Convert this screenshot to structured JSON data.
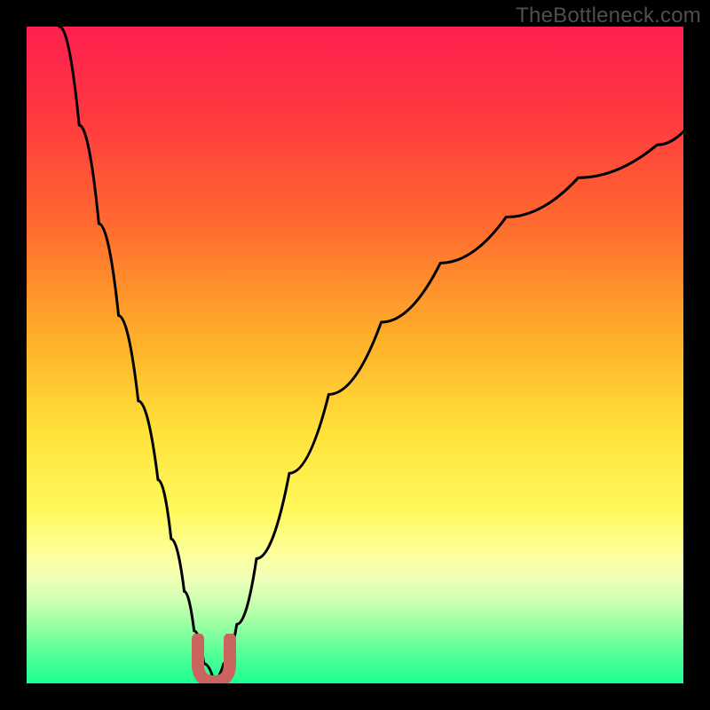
{
  "watermark": "TheBottleneck.com",
  "colors": {
    "black": "#000000",
    "marker": "#c9645f",
    "curve": "#000000",
    "gradient_stops": [
      {
        "pct": 0,
        "color": "#ff1f4f"
      },
      {
        "pct": 14,
        "color": "#ff3a3f"
      },
      {
        "pct": 30,
        "color": "#ff6a2f"
      },
      {
        "pct": 48,
        "color": "#ffb12a"
      },
      {
        "pct": 62,
        "color": "#ffe33a"
      },
      {
        "pct": 74,
        "color": "#fff95e"
      },
      {
        "pct": 80,
        "color": "#fdff9a"
      },
      {
        "pct": 84,
        "color": "#f0ffb8"
      },
      {
        "pct": 88,
        "color": "#c7ffb0"
      },
      {
        "pct": 92,
        "color": "#8bffa0"
      },
      {
        "pct": 96,
        "color": "#4cff97"
      },
      {
        "pct": 100,
        "color": "#1cff90"
      }
    ]
  },
  "chart_data": {
    "type": "line",
    "title": "",
    "xlabel": "",
    "ylabel": "",
    "xlim": [
      0,
      100
    ],
    "ylim": [
      0,
      100
    ],
    "series": [
      {
        "name": "bottleneck-curve",
        "x": [
          5,
          8,
          11,
          14,
          17,
          20,
          22,
          24,
          25.5,
          27,
          28.5,
          30,
          32,
          35,
          40,
          46,
          54,
          63,
          73,
          84,
          96,
          100
        ],
        "y": [
          100,
          85,
          70,
          56,
          43,
          31,
          22,
          14,
          8,
          3,
          0.5,
          3,
          9,
          19,
          32,
          44,
          55,
          64,
          71,
          77,
          82,
          84
        ]
      }
    ],
    "marker": {
      "name": "optimal-point",
      "x": 28.5,
      "y": 0.5,
      "shape": "U"
    },
    "note": "x/y are percentages of the plot area (0-100). y=0 is bottom, y=100 is top. Values estimated from pixels; axes unlabeled in source."
  }
}
